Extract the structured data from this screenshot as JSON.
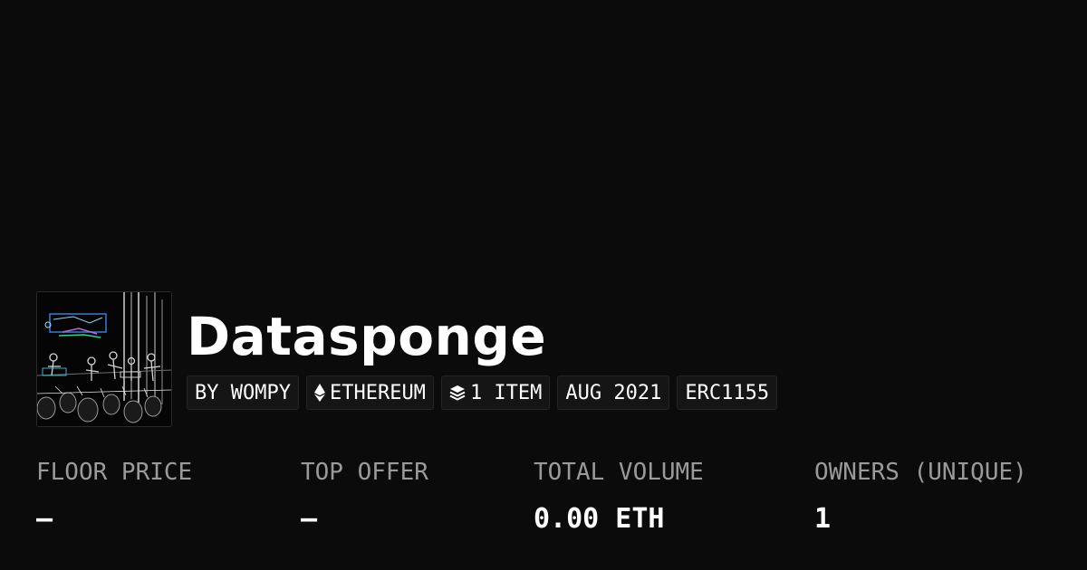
{
  "collection": {
    "name": "Datasponge",
    "thumbnail_icon": "concert-photo-edge-filter"
  },
  "tags": [
    {
      "label": "BY WOMPY",
      "icon": ""
    },
    {
      "label": "ETHEREUM",
      "icon": "ethereum-icon"
    },
    {
      "label": "1 ITEM",
      "icon": "layers-icon"
    },
    {
      "label": "AUG 2021",
      "icon": ""
    },
    {
      "label": "ERC1155",
      "icon": ""
    }
  ],
  "stats": {
    "floor_price": {
      "label": "FLOOR PRICE",
      "value": "—"
    },
    "top_offer": {
      "label": "TOP OFFER",
      "value": "—"
    },
    "total_volume": {
      "label": "TOTAL VOLUME",
      "value": "0.00 ETH"
    },
    "owners": {
      "label": "OWNERS (UNIQUE)",
      "value": "1"
    }
  },
  "colors": {
    "background": "#0b0b0b",
    "tag_background": "#151515",
    "label_gray": "#9a9a9a",
    "text": "#ffffff"
  }
}
